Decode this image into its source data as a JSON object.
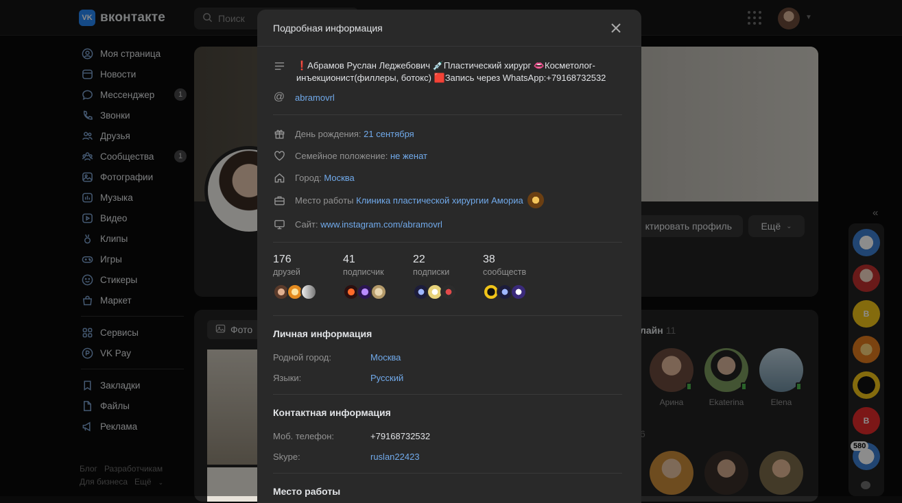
{
  "header": {
    "logo_text": "вконтакте",
    "logo_mark": "VK",
    "search_placeholder": "Поиск"
  },
  "sidebar": {
    "items": [
      {
        "label": "Моя страница",
        "icon": "user-circle-icon"
      },
      {
        "label": "Новости",
        "icon": "news-icon"
      },
      {
        "label": "Мессенджер",
        "icon": "message-icon",
        "badge": "1"
      },
      {
        "label": "Звонки",
        "icon": "phone-icon"
      },
      {
        "label": "Друзья",
        "icon": "friends-icon"
      },
      {
        "label": "Сообщества",
        "icon": "communities-icon",
        "badge": "1"
      },
      {
        "label": "Фотографии",
        "icon": "photo-icon"
      },
      {
        "label": "Музыка",
        "icon": "music-icon"
      },
      {
        "label": "Видео",
        "icon": "video-icon"
      },
      {
        "label": "Клипы",
        "icon": "clips-icon"
      },
      {
        "label": "Игры",
        "icon": "gamepad-icon"
      },
      {
        "label": "Стикеры",
        "icon": "smile-icon"
      },
      {
        "label": "Маркет",
        "icon": "bag-icon"
      }
    ],
    "items2": [
      {
        "label": "Сервисы",
        "icon": "grid-icon"
      },
      {
        "label": "VK Pay",
        "icon": "pay-icon"
      }
    ],
    "items3": [
      {
        "label": "Закладки",
        "icon": "bookmark-icon"
      },
      {
        "label": "Файлы",
        "icon": "file-icon"
      },
      {
        "label": "Реклама",
        "icon": "megaphone-icon"
      }
    ],
    "footer": [
      "Блог",
      "Разработчикам",
      "Для бизнеса",
      "Ещё"
    ]
  },
  "profile": {
    "edit_label": "ктировать профиль",
    "more_label": "Ещё"
  },
  "photos": {
    "tab_label": "Фото",
    "online_title": "лайн",
    "online_count": "11",
    "section2_count": "6",
    "friends": [
      {
        "name": "Арина"
      },
      {
        "name": "Ekaterina"
      },
      {
        "name": "Elena"
      }
    ]
  },
  "right_column": {
    "items": [
      "В",
      "В",
      "580"
    ]
  },
  "modal": {
    "title": "Подробная информация",
    "bio": "❗Абрамов Руслан Леджебович 💉Пластический хирург 👄Косметолог-инъекционист(филлеры, ботокс) 🟥Запись через WhatsApp:+79168732532",
    "username": "abramovrl",
    "birthday_label": "День рождения:",
    "birthday_value": "21 сентября",
    "family_label": "Семейное положение:",
    "family_value": "не женат",
    "city_label": "Город:",
    "city_value": "Москва",
    "work_label": "Место работы",
    "work_value": "Клиника пластической хирургии Амориа",
    "site_label": "Сайт:",
    "site_value": "www.instagram.com/abramovrl",
    "counters": [
      {
        "n": "176",
        "l": "друзей"
      },
      {
        "n": "41",
        "l": "подписчик"
      },
      {
        "n": "22",
        "l": "подписки"
      },
      {
        "n": "38",
        "l": "сообществ"
      }
    ],
    "personal_title": "Личная информация",
    "hometown_label": "Родной город:",
    "hometown_value": "Москва",
    "languages_label": "Языки:",
    "languages_value": "Русский",
    "contact_title": "Контактная информация",
    "phone_label": "Моб. телефон:",
    "phone_value": "+79168732532",
    "skype_label": "Skype:",
    "skype_value": "ruslan22423",
    "workplace_title": "Место работы"
  },
  "colors": {
    "accent": "#71aaeb",
    "brand": "#2787f5",
    "online": "#4bb34b"
  }
}
